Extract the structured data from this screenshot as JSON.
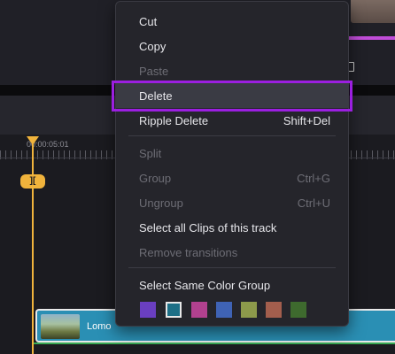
{
  "timeline": {
    "timecode": "00:00:05:01",
    "playhead_badge": "][",
    "clip_label": "Lomo"
  },
  "context_menu": {
    "items": {
      "cut": {
        "label": "Cut",
        "enabled": true
      },
      "copy": {
        "label": "Copy",
        "enabled": true
      },
      "paste": {
        "label": "Paste",
        "enabled": false
      },
      "delete": {
        "label": "Delete",
        "enabled": true,
        "highlighted": true
      },
      "ripple_delete": {
        "label": "Ripple Delete",
        "shortcut": "Shift+Del",
        "enabled": true
      },
      "split": {
        "label": "Split",
        "enabled": false
      },
      "group": {
        "label": "Group",
        "shortcut": "Ctrl+G",
        "enabled": false
      },
      "ungroup": {
        "label": "Ungroup",
        "shortcut": "Ctrl+U",
        "enabled": false
      },
      "select_all_track": {
        "label": "Select all Clips of this track",
        "enabled": true
      },
      "remove_transitions": {
        "label": "Remove transitions",
        "enabled": false
      },
      "select_color_group": {
        "label": "Select Same Color Group",
        "enabled": true
      }
    },
    "color_swatches": [
      "#6a3fc0",
      "#1d6f86",
      "#b2418f",
      "#3f63b5",
      "#8d9a4b",
      "#a35e4d",
      "#3e6a2e"
    ],
    "selected_swatch": "#1d6f86"
  },
  "colors": {
    "playhead": "#f0b33c",
    "clip": "#2a8fb4",
    "focus_outline": "#9b1fe0",
    "accent_bar": "#c04cd8"
  }
}
